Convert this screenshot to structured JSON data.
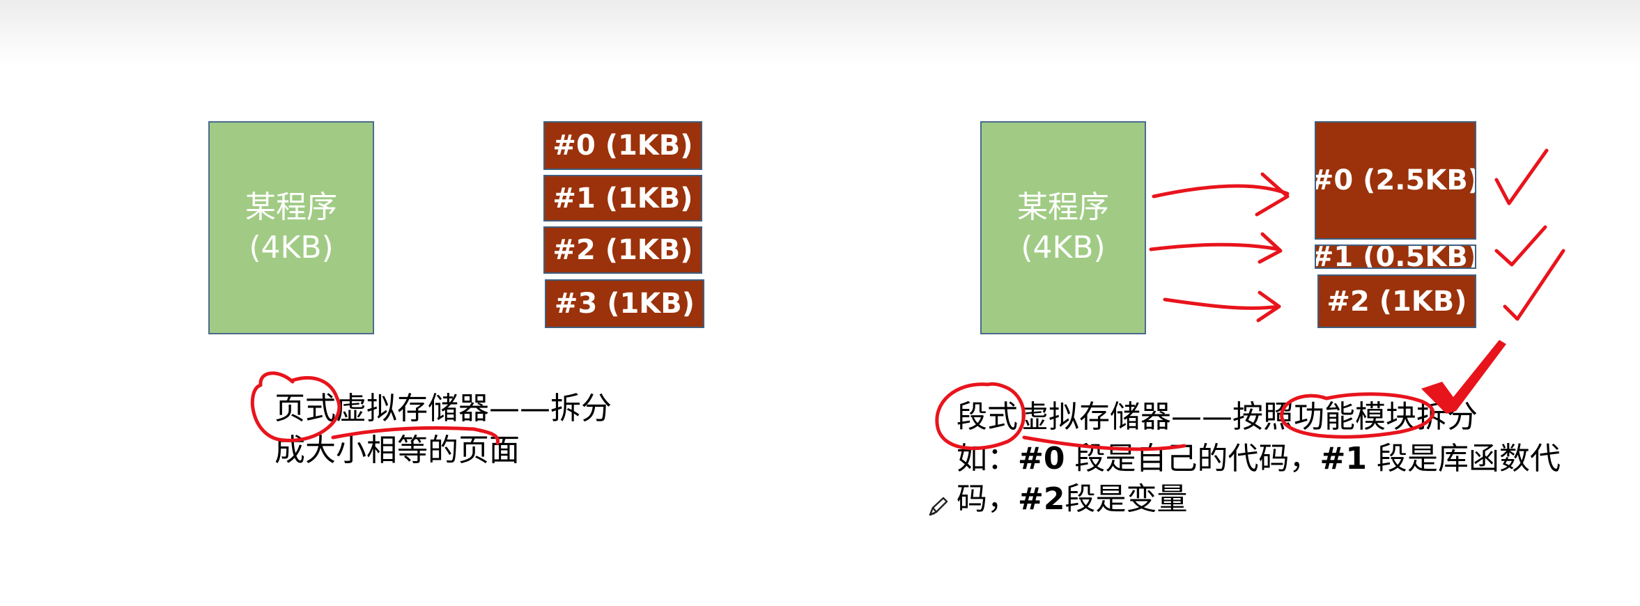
{
  "left_panel": {
    "program": {
      "name": "某程序",
      "size": "(4KB)"
    },
    "pages": [
      "#0 (1KB)",
      "#1 (1KB)",
      "#2 (1KB)",
      "#3 (1KB)"
    ],
    "caption_line1": "页式虚拟存储器——拆分",
    "caption_line2": "成大小相等的页面"
  },
  "right_panel": {
    "program": {
      "name": "某程序",
      "size": "(4KB)"
    },
    "segments": [
      "#0 (2.5KB)",
      "#1 (0.5KB)",
      "#2 (1KB)"
    ],
    "caption_line1": "段式虚拟存储器——按照功能模块拆分",
    "caption_line2_a": "如：",
    "caption_line2_b": "#0",
    "caption_line2_c": " 段是自己的代码，",
    "caption_line2_d": "#1",
    "caption_line2_e": " 段是库函数代",
    "caption_line3_a": "码，",
    "caption_line3_b": "#2",
    "caption_line3_c": "段是变量"
  },
  "colors": {
    "program_fill": "#a1cb85",
    "block_fill": "#9b320b",
    "annotation_ink": "#e8141c"
  },
  "icons": {
    "cursor": "pencil-icon"
  }
}
